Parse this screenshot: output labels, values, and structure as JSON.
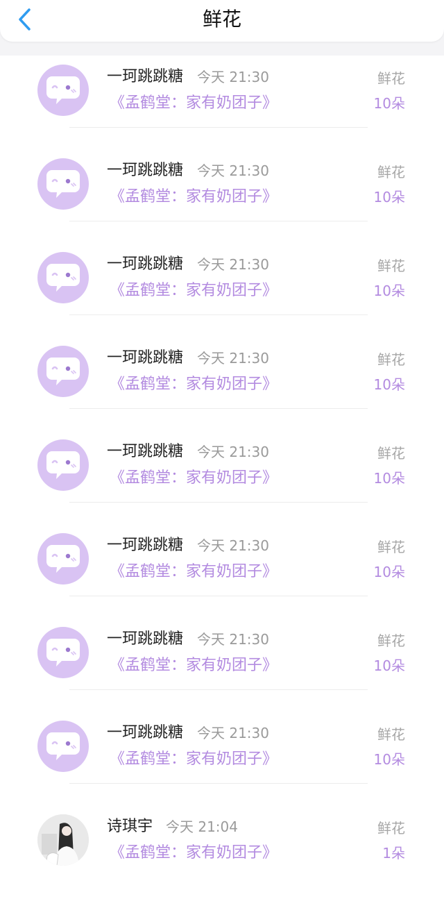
{
  "header": {
    "title": "鲜花",
    "back_icon": "chevron-left-icon",
    "accent_color": "#2f9cf0"
  },
  "colors": {
    "avatar_bg": "#d9c3f3",
    "book_text": "#b38be0",
    "muted_text": "#9a9a9a"
  },
  "items": [
    {
      "avatar": "chat-bubble-face-icon",
      "user": "一珂跳跳糖",
      "time": "今天 21:30",
      "book": "《孟鹤堂：家有奶团子》",
      "gift": "鲜花",
      "count": "10朵"
    },
    {
      "avatar": "chat-bubble-face-icon",
      "user": "一珂跳跳糖",
      "time": "今天 21:30",
      "book": "《孟鹤堂：家有奶团子》",
      "gift": "鲜花",
      "count": "10朵"
    },
    {
      "avatar": "chat-bubble-face-icon",
      "user": "一珂跳跳糖",
      "time": "今天 21:30",
      "book": "《孟鹤堂：家有奶团子》",
      "gift": "鲜花",
      "count": "10朵"
    },
    {
      "avatar": "chat-bubble-face-icon",
      "user": "一珂跳跳糖",
      "time": "今天 21:30",
      "book": "《孟鹤堂：家有奶团子》",
      "gift": "鲜花",
      "count": "10朵"
    },
    {
      "avatar": "chat-bubble-face-icon",
      "user": "一珂跳跳糖",
      "time": "今天 21:30",
      "book": "《孟鹤堂：家有奶团子》",
      "gift": "鲜花",
      "count": "10朵"
    },
    {
      "avatar": "chat-bubble-face-icon",
      "user": "一珂跳跳糖",
      "time": "今天 21:30",
      "book": "《孟鹤堂：家有奶团子》",
      "gift": "鲜花",
      "count": "10朵"
    },
    {
      "avatar": "chat-bubble-face-icon",
      "user": "一珂跳跳糖",
      "time": "今天 21:30",
      "book": "《孟鹤堂：家有奶团子》",
      "gift": "鲜花",
      "count": "10朵"
    },
    {
      "avatar": "chat-bubble-face-icon",
      "user": "一珂跳跳糖",
      "time": "今天 21:30",
      "book": "《孟鹤堂：家有奶团子》",
      "gift": "鲜花",
      "count": "10朵"
    },
    {
      "avatar": "user-photo",
      "user": "诗琪宇",
      "time": "今天 21:04",
      "book": "《孟鹤堂：家有奶团子》",
      "gift": "鲜花",
      "count": "1朵"
    }
  ]
}
